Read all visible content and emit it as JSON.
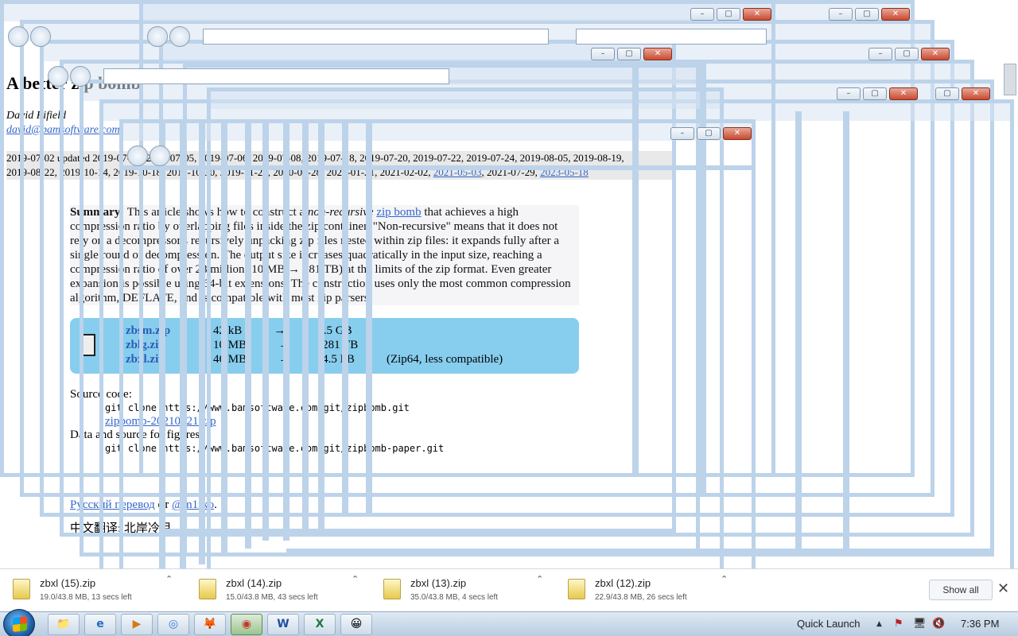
{
  "page": {
    "title": "A better zip bomb",
    "author": "David Fifield",
    "email": "david@bamsoftware.com",
    "dates_line1": "2019-07-02 updated 2019-07-03, 2019-07-05, 2019-07-06, 2019-07-08, 2019-07-18, 2019-07-20, 2019-07-22, 2019-07-24, 2019-08-05, 2019-08-19,",
    "dates_line2_text": "2019-08-22, 2019-10-14, 2019-10-18, 2019-10-30, 2019-11-28, 2020-07-28, 2021-01-21, 2021-02-02,",
    "dates_link1": "2021-05-03",
    "dates_mid": ", 2021-07-29, ",
    "dates_link2": "2023-05-18",
    "summary_label": "Summary:",
    "summary_a": " This article shows how to construct a ",
    "summary_em": "non-recursive",
    "summary_link": "zip bomb",
    "summary_b": " that achieves a high compression ratio by overlapping files inside the zip container. \"Non-recursive\" means that it does not rely on a decompressor's recursively unpacking zip files nested within zip files: it expands fully after a single round of decompression. The output size increases quadratically in the input size, reaching a compression ratio of over 28 million (10 MB → 281 TB) at the limits of the zip format. Even greater expansion is possible using 64-bit extensions. The construction uses only the most common compression algorithm, DEFLATE, and is compatible with most zip parsers.",
    "files": [
      {
        "name": "zbsm.zip",
        "size": "42 kB",
        "arrow": "→",
        "out": "5.5 GB",
        "note": ""
      },
      {
        "name": "zblg.zip",
        "size": "10 MB",
        "arrow": "→",
        "out": "281 TB",
        "note": ""
      },
      {
        "name": "zbxl.zip",
        "size": "46 MB",
        "arrow": "→",
        "out": "4.5 PB",
        "note": "(Zip64, less compatible)"
      }
    ],
    "source_label": "Source code:",
    "source_cmd": "git clone https://www.bamsoftware.com/git/zipbomb.git",
    "source_link": "zipbomb-20210121.zip",
    "data_label": "Data and source for figures:",
    "data_cmd": "git clone https://www.bamsoftware.com/git/zipbomb-paper.git",
    "trans1_link": "Русский перевод",
    "trans1_mid": " от ",
    "trans1_author": "@m1rko",
    "trans1_end": ".",
    "trans2": "中文翻译: 北岸冷月"
  },
  "downloads": [
    {
      "name": "zbxl (15).zip",
      "meta": "19.0/43.8 MB, 13 secs left"
    },
    {
      "name": "zbxl (14).zip",
      "meta": "15.0/43.8 MB, 43 secs left"
    },
    {
      "name": "zbxl (13).zip",
      "meta": "35.0/43.8 MB, 4 secs left"
    },
    {
      "name": "zbxl (12).zip",
      "meta": "22.9/43.8 MB, 26 secs left"
    }
  ],
  "download_bar": {
    "show_all": "Show all",
    "close": "✕",
    "caret": "⌃"
  },
  "window_buttons": {
    "minimize": "–",
    "maximize": "▢",
    "close": "✕"
  },
  "taskbar": {
    "quick_launch": "Quick Launch",
    "clock": "7:36 PM",
    "tray_arrow": "▲",
    "buttons": [
      {
        "icon": "📁",
        "name": "explorer"
      },
      {
        "icon": "e",
        "name": "internet-explorer"
      },
      {
        "icon": "▶",
        "name": "media-player"
      },
      {
        "icon": "◎",
        "name": "chrome-pinned"
      },
      {
        "icon": "🦊",
        "name": "firefox"
      },
      {
        "icon": "◉",
        "name": "chrome"
      },
      {
        "icon": "W",
        "name": "word"
      },
      {
        "icon": "X",
        "name": "excel"
      },
      {
        "icon": "😀",
        "name": "messenger"
      }
    ]
  }
}
